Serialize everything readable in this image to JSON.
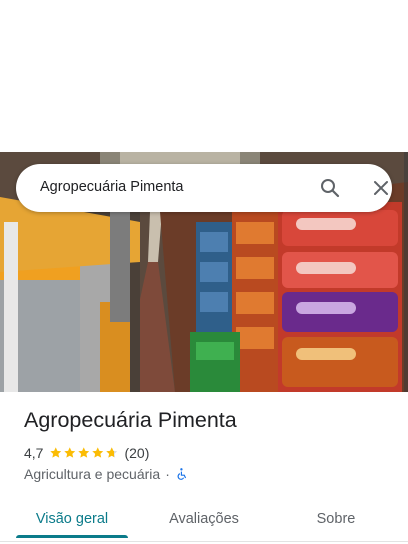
{
  "search": {
    "value": "Agropecuária Pimenta"
  },
  "place": {
    "name": "Agropecuária Pimenta",
    "rating": "4,7",
    "rating_fraction": 0.94,
    "reviews": "(20)",
    "category": "Agricultura e pecuária",
    "separator": "·"
  },
  "tabs": [
    {
      "label": "Visão geral",
      "active": true
    },
    {
      "label": "Avaliações",
      "active": false
    },
    {
      "label": "Sobre",
      "active": false
    }
  ],
  "colors": {
    "accent": "#0b7b8a",
    "star": "#fbbc04",
    "accessibility": "#1a73e8"
  },
  "icons": {
    "search": "search-icon",
    "close": "close-icon",
    "accessibility": "wheelchair-icon",
    "star": "star-icon"
  }
}
